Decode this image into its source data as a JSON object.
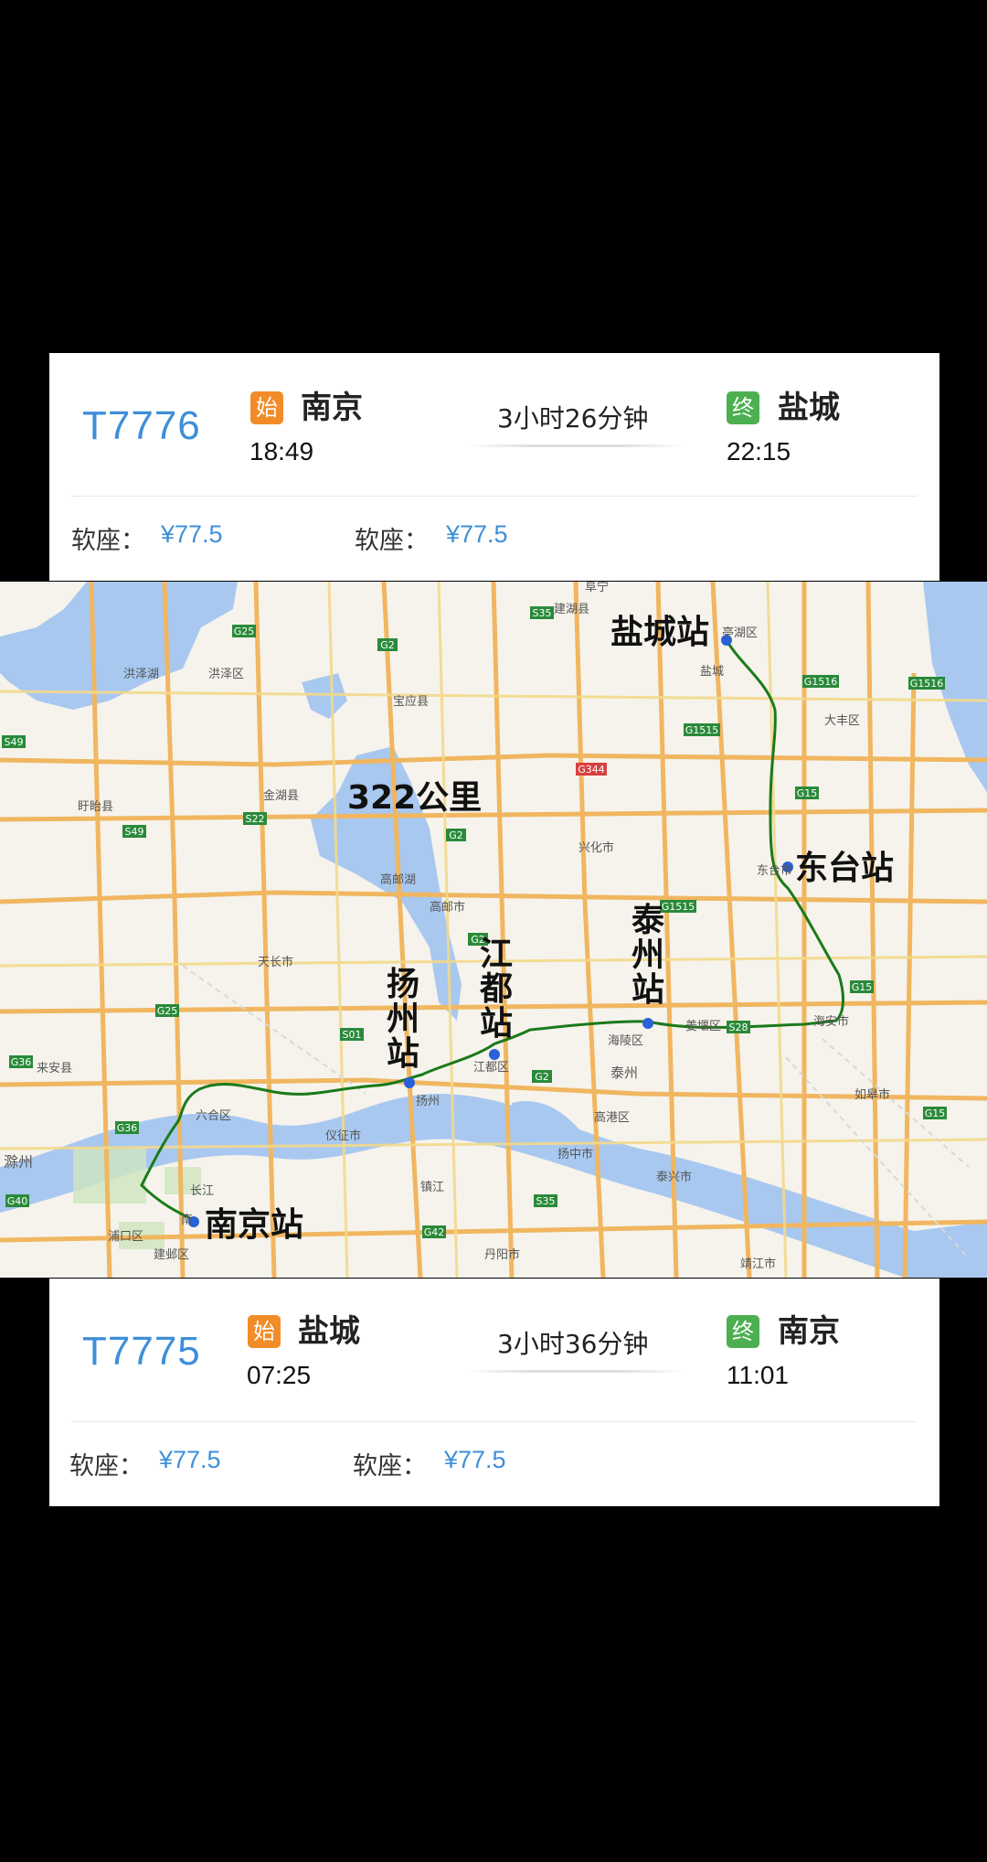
{
  "cards": [
    {
      "train": "T7776",
      "start_tag": "始",
      "from": "南京",
      "depart": "18:49",
      "duration": "3小时26分钟",
      "end_tag": "终",
      "to": "盐城",
      "arrive": "22:15",
      "seats": [
        {
          "label": "软座：",
          "price": "¥77.5"
        },
        {
          "label": "软座：",
          "price": "¥77.5"
        }
      ]
    },
    {
      "train": "T7775",
      "start_tag": "始",
      "from": "盐城",
      "depart": "07:25",
      "duration": "3小时36分钟",
      "end_tag": "终",
      "to": "南京",
      "arrive": "11:01",
      "seats": [
        {
          "label": "软座：",
          "price": "¥77.5"
        },
        {
          "label": "软座：",
          "price": "¥77.5"
        }
      ]
    }
  ],
  "map": {
    "distance": "322公里",
    "route_color": "#1a7a1a",
    "station_color": "#2a60d8",
    "stations": {
      "yancheng": "盐城站",
      "dongtai": "东台站",
      "taizhou": "泰州站",
      "jiangdu": "江都站",
      "yangzhou": "扬州站",
      "nanjing": "南京站"
    },
    "places": {
      "hongze_lake": "洪泽湖",
      "hongze_qu": "洪泽区",
      "jinhu": "金湖县",
      "xuyi": "盱眙县",
      "baoying": "宝应县",
      "gaoyou_lake": "高邮湖",
      "gaoyou": "高邮市",
      "tianchang": "天长市",
      "laian": "来安县",
      "chuzhou": "滁州",
      "liuhe": "六合区",
      "yizheng": "仪征市",
      "yangzhou": "扬州",
      "jiangdu": "江都区",
      "zhenjiang": "镇江",
      "danyang": "丹阳市",
      "yangzhong": "扬中市",
      "taixing": "泰兴市",
      "gaogang": "高港区",
      "taizhou": "泰州",
      "hailing": "海陵区",
      "jiangyan": "姜堰区",
      "xinghua": "兴化市",
      "jianhu": "建湖县",
      "yancheng": "盐城",
      "tinghu": "亭湖区",
      "dafeng": "大丰区",
      "dongtai": "东台市",
      "haian": "海安市",
      "rugao": "如皋市",
      "jingjiang": "靖江市",
      "changjiang": "长江",
      "pukou": "浦口区",
      "jianye": "建邺区",
      "nan": "南",
      "funing": "阜宁"
    },
    "roads": {
      "g25": "G25",
      "g2a": "G2",
      "g2b": "G2",
      "g2c": "G2",
      "g2d": "G2",
      "s35": "S35",
      "s49a": "S49",
      "s49b": "S49",
      "s22": "S22",
      "g344": "G344",
      "g1515a": "G1515",
      "g1515b": "G1515",
      "g1516a": "G1516",
      "g1516b": "G1516",
      "g15a": "G15",
      "g15b": "G15",
      "g15c": "G15",
      "s28": "S28",
      "s01": "S01",
      "g36a": "G36",
      "g36b": "G36",
      "g25b": "G25",
      "g40": "G40",
      "g42": "G42",
      "s35b": "S35"
    }
  }
}
